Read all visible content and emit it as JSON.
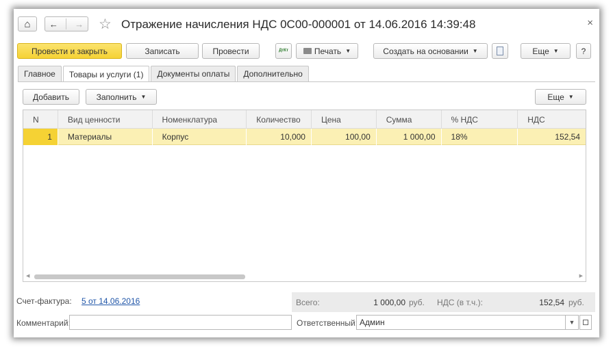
{
  "window": {
    "title": "Отражение начисления НДС 0С00-000001 от 14.06.2016 14:39:48",
    "close": "×"
  },
  "nav": {
    "home": "⌂",
    "back": "←",
    "forward": "→",
    "favorite": "☆"
  },
  "toolbar": {
    "post_and_close": "Провести и закрыть",
    "save": "Записать",
    "post": "Провести",
    "dtkt": "ДтКт",
    "print": "Печать",
    "create_based_on": "Создать на основании",
    "more": "Еще",
    "help": "?"
  },
  "tabs": [
    {
      "label": "Главное",
      "active": false
    },
    {
      "label": "Товары и услуги (1)",
      "active": true
    },
    {
      "label": "Документы оплаты",
      "active": false
    },
    {
      "label": "Дополнительно",
      "active": false
    }
  ],
  "table_toolbar": {
    "add": "Добавить",
    "fill": "Заполнить",
    "more": "Еще"
  },
  "table": {
    "columns": [
      "N",
      "Вид ценности",
      "Номенклатура",
      "Количество",
      "Цена",
      "Сумма",
      "% НДС",
      "НДС"
    ],
    "rows": [
      {
        "n": "1",
        "value_type": "Материалы",
        "item": "Корпус",
        "quantity": "10,000",
        "price": "100,00",
        "amount": "1 000,00",
        "vat_rate": "18%",
        "vat": "152,54"
      }
    ]
  },
  "footer": {
    "invoice_label": "Счет-фактура:",
    "invoice_link": "5 от 14.06.2016",
    "total_label": "Всего:",
    "total_value": "1 000,00",
    "total_currency": "руб.",
    "vat_label": "НДС (в т.ч.):",
    "vat_value": "152,54",
    "vat_currency": "руб.",
    "comment_label": "Комментарий:",
    "comment_value": "",
    "responsible_label": "Ответственный:",
    "responsible_value": "Админ"
  },
  "colors": {
    "primary_button": "#f5d234",
    "selected_row": "#fbf0b4",
    "link": "#1f55a8"
  }
}
